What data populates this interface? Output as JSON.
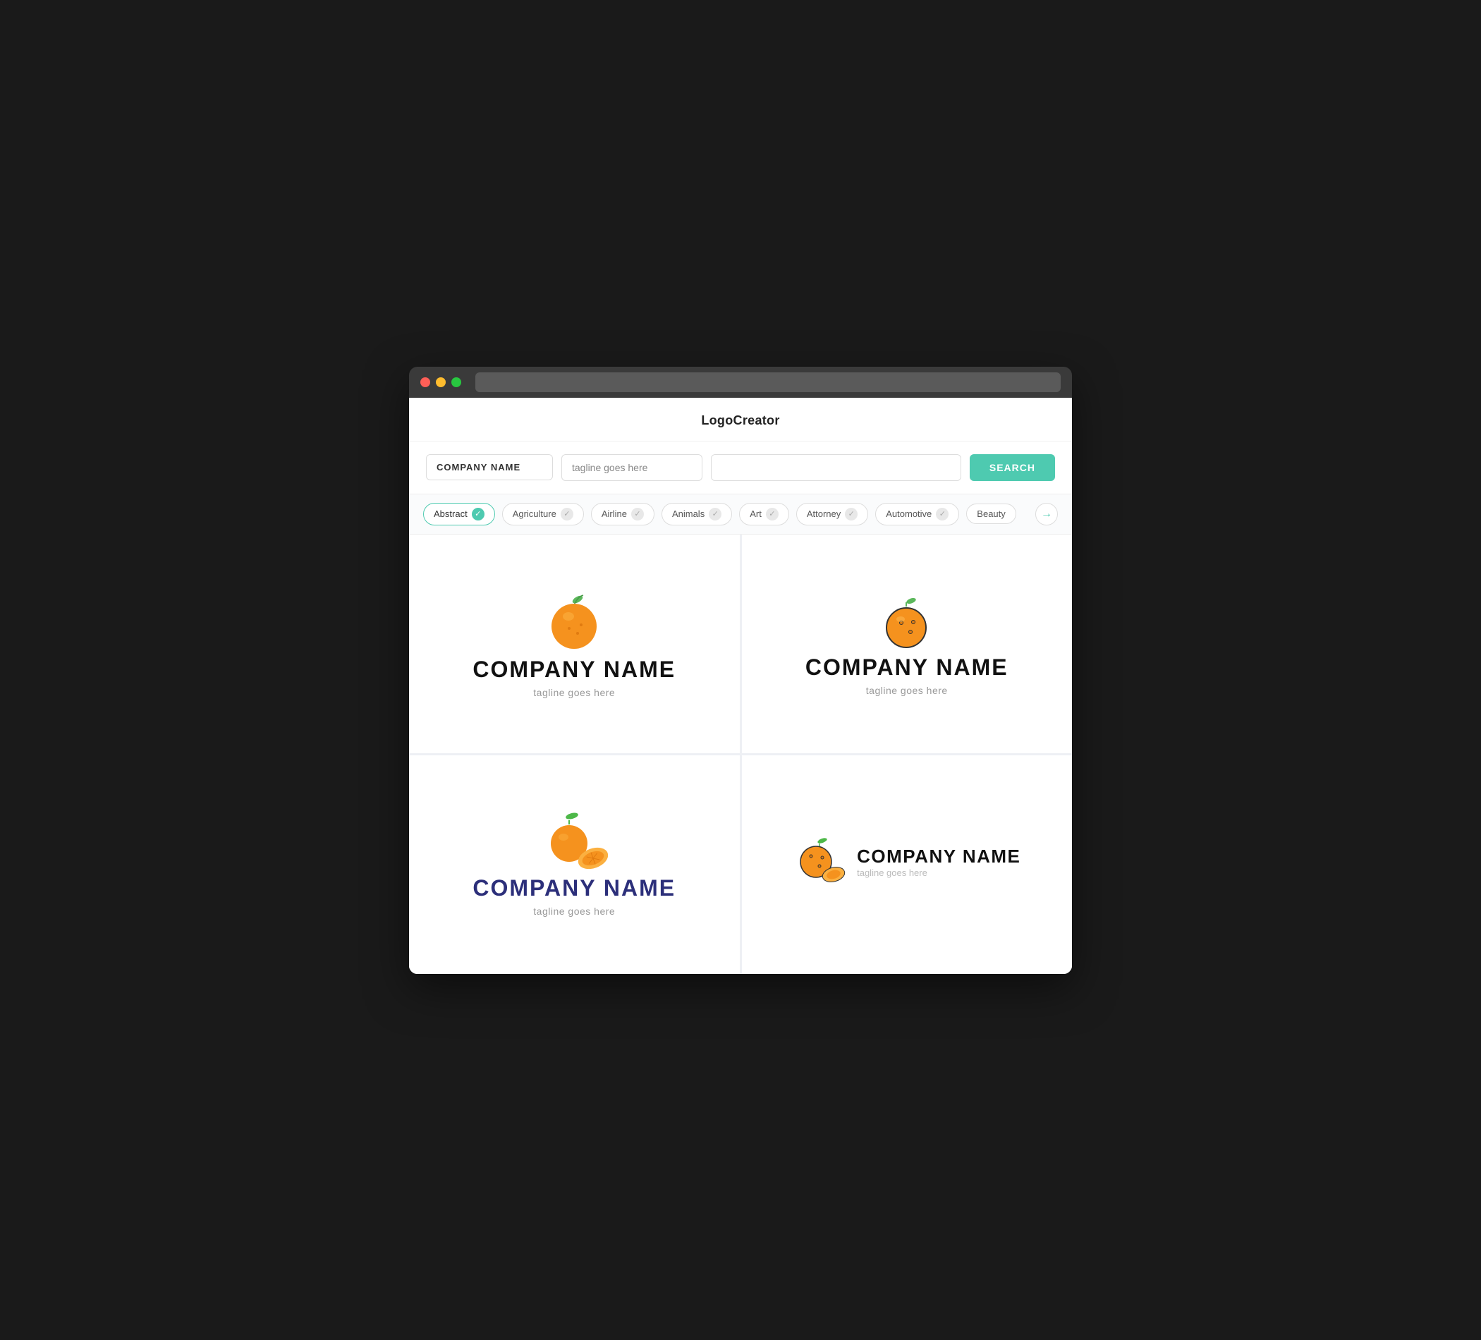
{
  "app": {
    "title": "LogoCreator"
  },
  "search": {
    "company_placeholder": "COMPANY NAME",
    "tagline_placeholder": "tagline goes here",
    "keyword_placeholder": "",
    "button_label": "SEARCH"
  },
  "filters": [
    {
      "id": "abstract",
      "label": "Abstract",
      "active": true
    },
    {
      "id": "agriculture",
      "label": "Agriculture",
      "active": false
    },
    {
      "id": "airline",
      "label": "Airline",
      "active": false
    },
    {
      "id": "animals",
      "label": "Animals",
      "active": false
    },
    {
      "id": "art",
      "label": "Art",
      "active": false
    },
    {
      "id": "attorney",
      "label": "Attorney",
      "active": false
    },
    {
      "id": "automotive",
      "label": "Automotive",
      "active": false
    },
    {
      "id": "beauty",
      "label": "Beauty",
      "active": false
    }
  ],
  "logos": [
    {
      "id": "logo-1",
      "style": "classic",
      "company": "COMPANY NAME",
      "tagline": "tagline goes here"
    },
    {
      "id": "logo-2",
      "style": "outline",
      "company": "COMPANY NAME",
      "tagline": "tagline goes here"
    },
    {
      "id": "logo-3",
      "style": "split",
      "company": "COMPANY NAME",
      "tagline": "tagline goes here"
    },
    {
      "id": "logo-4",
      "style": "inline",
      "company": "COMPANY NAME",
      "tagline": "tagline goes here"
    }
  ],
  "colors": {
    "teal": "#4ecab0",
    "navy": "#2c2f7a",
    "orange": "#f5921e",
    "dark_orange": "#e07b10"
  }
}
